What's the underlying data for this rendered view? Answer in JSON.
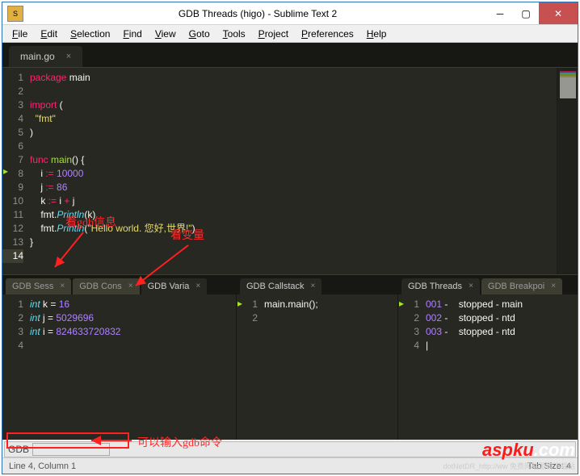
{
  "window": {
    "title": "GDB Threads (higo) - Sublime Text 2"
  },
  "menus": [
    "File",
    "Edit",
    "Selection",
    "Find",
    "View",
    "Goto",
    "Tools",
    "Project",
    "Preferences",
    "Help"
  ],
  "main_tab": {
    "label": "main.go"
  },
  "code_main": {
    "lines": [
      {
        "n": "1",
        "h": "<span class='tok-kw'>package</span> <span class='tok-pkg'>main</span>"
      },
      {
        "n": "2",
        "h": ""
      },
      {
        "n": "3",
        "h": "<span class='tok-kw'>import</span> ("
      },
      {
        "n": "4",
        "h": "  <span class='tok-str'>\"fmt\"</span>"
      },
      {
        "n": "5",
        "h": ")"
      },
      {
        "n": "6",
        "h": ""
      },
      {
        "n": "7",
        "h": "<span class='tok-kw'>func</span> <span class='tok-fn'>main</span>() {"
      },
      {
        "n": "8",
        "h": "    i <span class='tok-op'>:=</span> <span class='tok-num'>10000</span>"
      },
      {
        "n": "9",
        "h": "    j <span class='tok-op'>:=</span> <span class='tok-num'>86</span>"
      },
      {
        "n": "10",
        "h": "    k <span class='tok-op'>:=</span> i <span class='tok-op'>+</span> j"
      },
      {
        "n": "11",
        "h": "    fmt.<span class='tok-type'>Println</span>(k)"
      },
      {
        "n": "12",
        "h": "    fmt.<span class='tok-type'>Println</span>(<span class='tok-str'>\"Hello world. 您好,世界!\"</span>)"
      },
      {
        "n": "13",
        "h": "}"
      },
      {
        "n": "14",
        "h": ""
      }
    ],
    "current_line": 14,
    "breakpoint_line": 8
  },
  "bottom": {
    "left": {
      "tabs": [
        "GDB Sess",
        "GDB Cons",
        "GDB Varia"
      ],
      "lines": [
        {
          "n": "1",
          "h": "<span class='tok-type'>int</span> k = <span class='tok-num'>16</span>"
        },
        {
          "n": "2",
          "h": "<span class='tok-type'>int</span> j = <span class='tok-num'>5029696</span>"
        },
        {
          "n": "3",
          "h": "<span class='tok-type'>int</span> i = <span class='tok-num'>824633720832</span>"
        },
        {
          "n": "4",
          "h": ""
        }
      ]
    },
    "mid": {
      "tabs": [
        "GDB Callstack"
      ],
      "lines": [
        {
          "n": "1",
          "h": "main.main();"
        },
        {
          "n": "2",
          "h": ""
        }
      ]
    },
    "right": {
      "tabs": [
        "GDB Threads",
        "GDB Breakpoi"
      ],
      "lines": [
        {
          "n": "1",
          "h": "<span class='tok-num'>001</span> -    stopped - main"
        },
        {
          "n": "2",
          "h": "<span class='tok-num'>002</span> -    stopped - ntd"
        },
        {
          "n": "3",
          "h": "<span class='tok-num'>003</span> -    stopped - ntd"
        },
        {
          "n": "4",
          "h": "|"
        }
      ]
    }
  },
  "gdb_bar": {
    "label": "GDB"
  },
  "status": {
    "left": "Line 4, Column 1",
    "right": "Tab Size: 4"
  },
  "annotations": {
    "a1": "看gdb信息",
    "a2": "看变量",
    "a3": "可以输入gdb命令"
  },
  "watermark": {
    "brand_red": "aspku",
    "brand_suffix": ".com",
    "sub": "dotNetDR_http://ww   免费网站源码下载站"
  }
}
